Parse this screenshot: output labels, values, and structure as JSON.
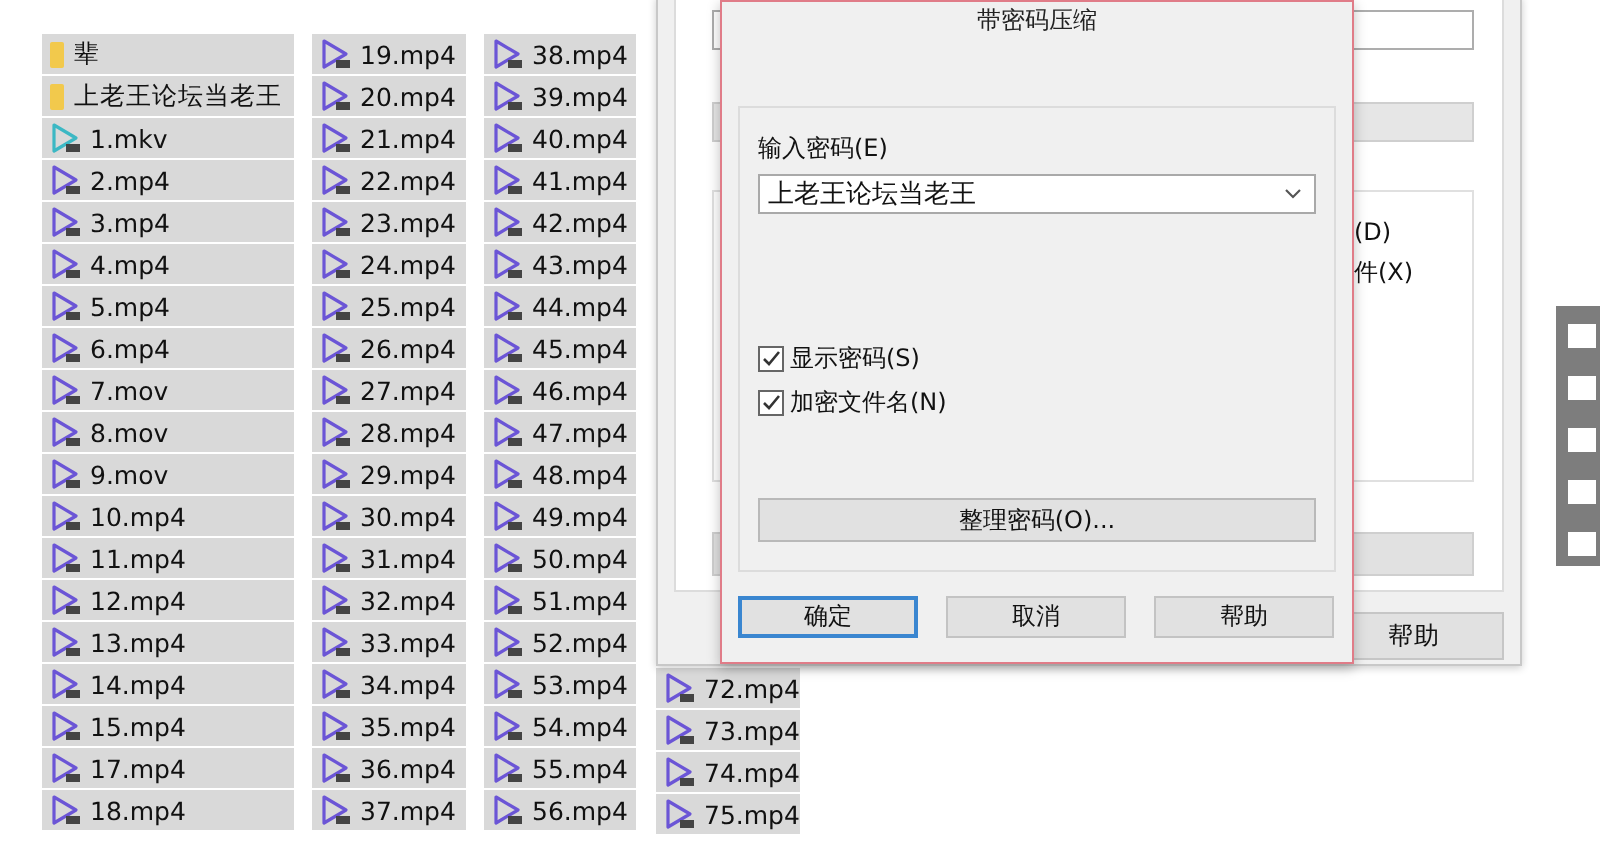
{
  "file_columns": [
    {
      "items": [
        {
          "name": "辈",
          "kind": "folder",
          "color": "#f2c94c",
          "selected": true
        },
        {
          "name": "上老王论坛当老王",
          "kind": "folder",
          "color": "#f2c94c",
          "selected": true
        },
        {
          "name": "1.mkv",
          "kind": "video",
          "color": "#3cb8c4",
          "selected": true
        },
        {
          "name": "2.mp4",
          "kind": "video",
          "color": "#6b55d6",
          "selected": true
        },
        {
          "name": "3.mp4",
          "kind": "video",
          "color": "#6b55d6",
          "selected": true
        },
        {
          "name": "4.mp4",
          "kind": "video",
          "color": "#6b55d6",
          "selected": true
        },
        {
          "name": "5.mp4",
          "kind": "video",
          "color": "#6b55d6",
          "selected": true
        },
        {
          "name": "6.mp4",
          "kind": "video",
          "color": "#6b55d6",
          "selected": true
        },
        {
          "name": "7.mov",
          "kind": "video",
          "color": "#6b55d6",
          "selected": true
        },
        {
          "name": "8.mov",
          "kind": "video",
          "color": "#6b55d6",
          "selected": true
        },
        {
          "name": "9.mov",
          "kind": "video",
          "color": "#6b55d6",
          "selected": true
        },
        {
          "name": "10.mp4",
          "kind": "video",
          "color": "#6b55d6",
          "selected": true
        },
        {
          "name": "11.mp4",
          "kind": "video",
          "color": "#6b55d6",
          "selected": true
        },
        {
          "name": "12.mp4",
          "kind": "video",
          "color": "#6b55d6",
          "selected": true
        },
        {
          "name": "13.mp4",
          "kind": "video",
          "color": "#6b55d6",
          "selected": true
        },
        {
          "name": "14.mp4",
          "kind": "video",
          "color": "#6b55d6",
          "selected": true
        },
        {
          "name": "15.mp4",
          "kind": "video",
          "color": "#6b55d6",
          "selected": true
        },
        {
          "name": "17.mp4",
          "kind": "video",
          "color": "#6b55d6",
          "selected": true
        },
        {
          "name": "18.mp4",
          "kind": "video",
          "color": "#6b55d6",
          "selected": true
        }
      ]
    },
    {
      "items": [
        {
          "name": "19.mp4",
          "kind": "video",
          "color": "#6b55d6",
          "selected": true
        },
        {
          "name": "20.mp4",
          "kind": "video",
          "color": "#6b55d6",
          "selected": true
        },
        {
          "name": "21.mp4",
          "kind": "video",
          "color": "#6b55d6",
          "selected": true
        },
        {
          "name": "22.mp4",
          "kind": "video",
          "color": "#6b55d6",
          "selected": true
        },
        {
          "name": "23.mp4",
          "kind": "video",
          "color": "#6b55d6",
          "selected": true
        },
        {
          "name": "24.mp4",
          "kind": "video",
          "color": "#6b55d6",
          "selected": true
        },
        {
          "name": "25.mp4",
          "kind": "video",
          "color": "#6b55d6",
          "selected": true
        },
        {
          "name": "26.mp4",
          "kind": "video",
          "color": "#6b55d6",
          "selected": true
        },
        {
          "name": "27.mp4",
          "kind": "video",
          "color": "#6b55d6",
          "selected": true
        },
        {
          "name": "28.mp4",
          "kind": "video",
          "color": "#6b55d6",
          "selected": true
        },
        {
          "name": "29.mp4",
          "kind": "video",
          "color": "#6b55d6",
          "selected": true
        },
        {
          "name": "30.mp4",
          "kind": "video",
          "color": "#6b55d6",
          "selected": true
        },
        {
          "name": "31.mp4",
          "kind": "video",
          "color": "#6b55d6",
          "selected": true
        },
        {
          "name": "32.mp4",
          "kind": "video",
          "color": "#6b55d6",
          "selected": true
        },
        {
          "name": "33.mp4",
          "kind": "video",
          "color": "#6b55d6",
          "selected": true
        },
        {
          "name": "34.mp4",
          "kind": "video",
          "color": "#6b55d6",
          "selected": true
        },
        {
          "name": "35.mp4",
          "kind": "video",
          "color": "#6b55d6",
          "selected": true
        },
        {
          "name": "36.mp4",
          "kind": "video",
          "color": "#6b55d6",
          "selected": true
        },
        {
          "name": "37.mp4",
          "kind": "video",
          "color": "#6b55d6",
          "selected": true
        }
      ]
    },
    {
      "items": [
        {
          "name": "38.mp4",
          "kind": "video",
          "color": "#6b55d6",
          "selected": true
        },
        {
          "name": "39.mp4",
          "kind": "video",
          "color": "#6b55d6",
          "selected": true
        },
        {
          "name": "40.mp4",
          "kind": "video",
          "color": "#6b55d6",
          "selected": true
        },
        {
          "name": "41.mp4",
          "kind": "video",
          "color": "#6b55d6",
          "selected": true
        },
        {
          "name": "42.mp4",
          "kind": "video",
          "color": "#6b55d6",
          "selected": true
        },
        {
          "name": "43.mp4",
          "kind": "video",
          "color": "#6b55d6",
          "selected": true
        },
        {
          "name": "44.mp4",
          "kind": "video",
          "color": "#6b55d6",
          "selected": true
        },
        {
          "name": "45.mp4",
          "kind": "video",
          "color": "#6b55d6",
          "selected": true
        },
        {
          "name": "46.mp4",
          "kind": "video",
          "color": "#6b55d6",
          "selected": true
        },
        {
          "name": "47.mp4",
          "kind": "video",
          "color": "#6b55d6",
          "selected": true
        },
        {
          "name": "48.mp4",
          "kind": "video",
          "color": "#6b55d6",
          "selected": true
        },
        {
          "name": "49.mp4",
          "kind": "video",
          "color": "#6b55d6",
          "selected": true
        },
        {
          "name": "50.mp4",
          "kind": "video",
          "color": "#6b55d6",
          "selected": true
        },
        {
          "name": "51.mp4",
          "kind": "video",
          "color": "#6b55d6",
          "selected": true
        },
        {
          "name": "52.mp4",
          "kind": "video",
          "color": "#6b55d6",
          "selected": true
        },
        {
          "name": "53.mp4",
          "kind": "video",
          "color": "#6b55d6",
          "selected": true
        },
        {
          "name": "54.mp4",
          "kind": "video",
          "color": "#6b55d6",
          "selected": true
        },
        {
          "name": "55.mp4",
          "kind": "video",
          "color": "#6b55d6",
          "selected": true
        },
        {
          "name": "56.mp4",
          "kind": "video",
          "color": "#6b55d6",
          "selected": true
        }
      ]
    },
    {
      "items": [
        {
          "name": "72.mp4",
          "kind": "video",
          "color": "#6b55d6",
          "selected": true
        },
        {
          "name": "73.mp4",
          "kind": "video",
          "color": "#6b55d6",
          "selected": true
        },
        {
          "name": "74.mp4",
          "kind": "video",
          "color": "#6b55d6",
          "selected": true
        },
        {
          "name": "75.mp4",
          "kind": "video",
          "color": "#6b55d6",
          "selected": true
        }
      ]
    }
  ],
  "back_dialog": {
    "option_texts": [
      "(D)",
      "件(X)"
    ],
    "buttons": [
      {
        "label": "帮助"
      }
    ]
  },
  "dialog": {
    "title": "带密码压缩",
    "password": {
      "label": "输入密码(E)",
      "value": "上老王论坛当老王"
    },
    "options": [
      {
        "label": "显示密码(S)",
        "checked": true
      },
      {
        "label": "加密文件名(N)",
        "checked": true
      }
    ],
    "manage_button": "整理密码(O)...",
    "buttons": [
      {
        "label": "确定",
        "default": true
      },
      {
        "label": "取消",
        "default": false
      },
      {
        "label": "帮助",
        "default": false
      }
    ]
  }
}
